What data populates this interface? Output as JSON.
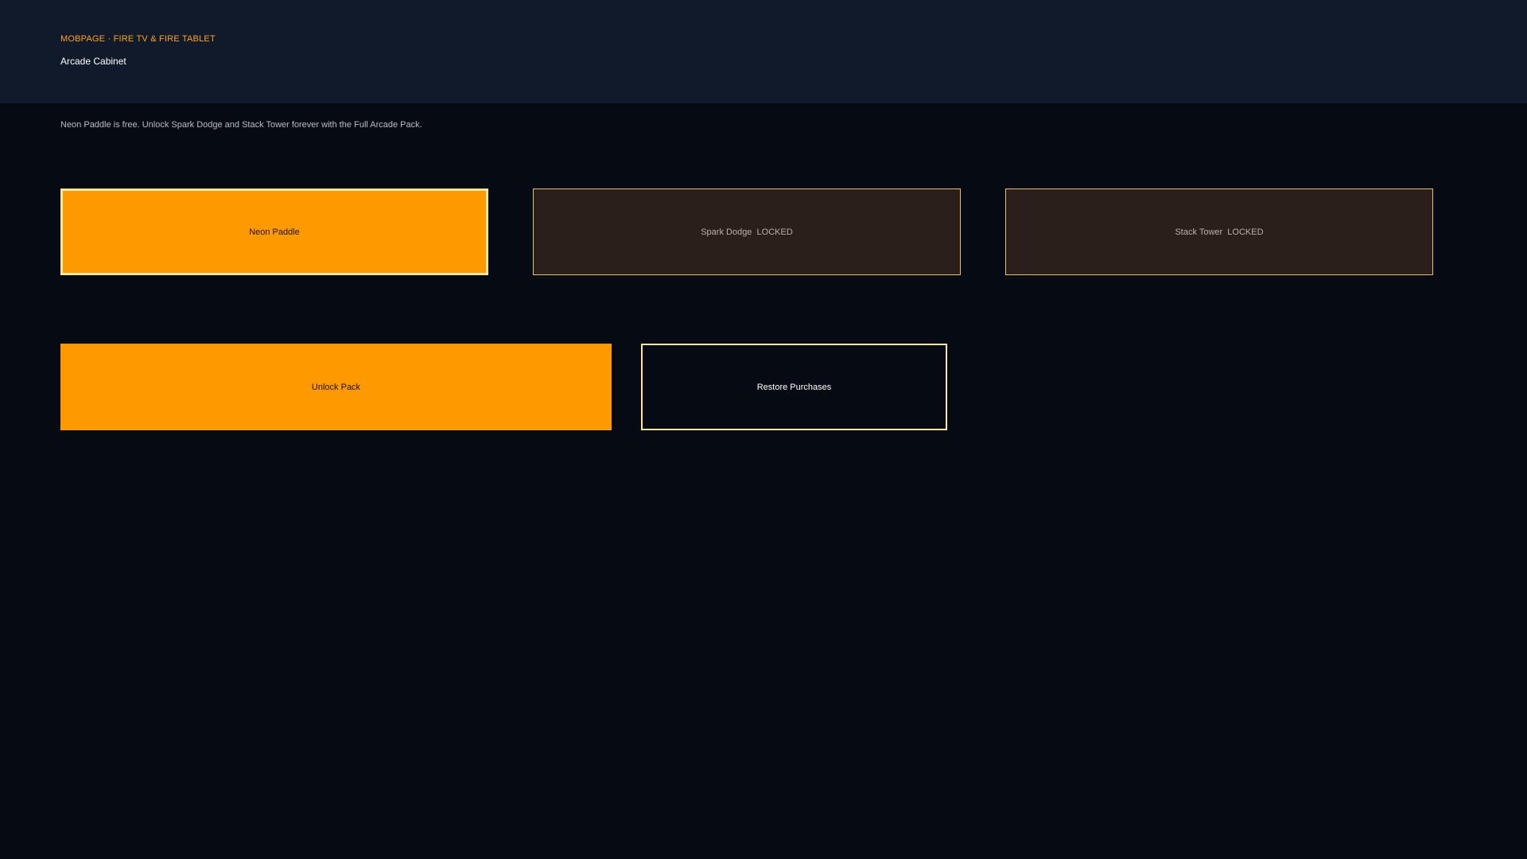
{
  "header": {
    "eyebrow": "MOBPAGE · FIRE TV & FIRE TABLET",
    "title": "Arcade Cabinet"
  },
  "description": "Neon Paddle is free. Unlock Spark Dodge and Stack Tower forever with the Full Arcade Pack.",
  "games": [
    {
      "label": "Neon Paddle",
      "state": "selected"
    },
    {
      "label": "Spark Dodge  LOCKED",
      "state": "locked"
    },
    {
      "label": "Stack Tower  LOCKED",
      "state": "locked"
    }
  ],
  "actions": {
    "unlock_label": "Unlock Pack",
    "restore_label": "Restore Purchases"
  },
  "colors": {
    "accent": "#ff9900",
    "focus_border": "#ffe7a3",
    "header_bg": "#111a2b",
    "page_bg": "#060b13",
    "locked_bg": "#2b1f1c"
  }
}
